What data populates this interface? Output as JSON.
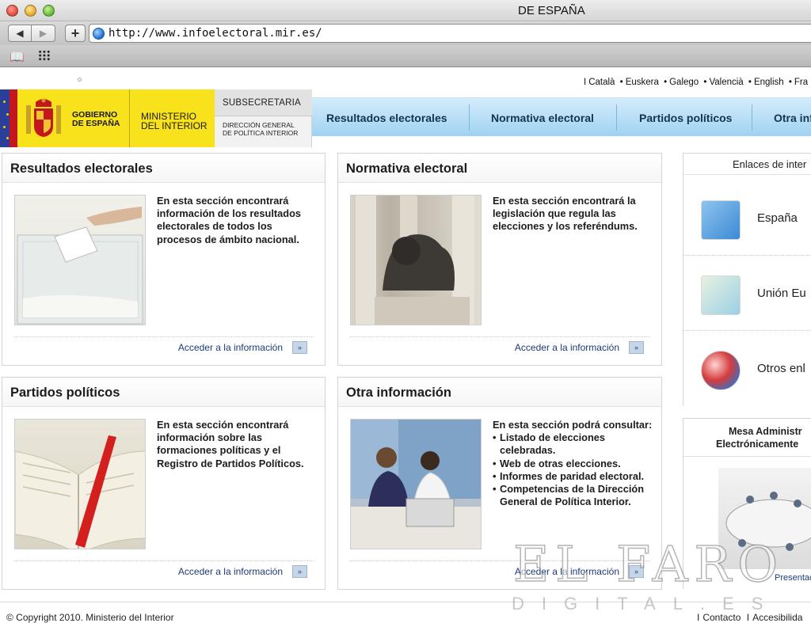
{
  "browser": {
    "window_title": "DE ESPAÑA",
    "url": "http://www.infoelectoral.mir.es/"
  },
  "languages": [
    "Català",
    "Euskera",
    "Galego",
    "Valencià",
    "English",
    "Fra"
  ],
  "header": {
    "gobierno": "GOBIERNO\nDE ESPAÑA",
    "ministerio": "MINISTERIO\nDEL INTERIOR",
    "subsecretaria": "SUBSECRETARIA",
    "direccion": "DIRECCIÓN GENERAL\nDE POLÍTICA INTERIOR",
    "nav": [
      "Resultados electorales",
      "Normativa electoral",
      "Partidos políticos",
      "Otra inf"
    ]
  },
  "cards": [
    {
      "title": "Resultados electorales",
      "desc": "En esta sección encontrará información de los resultados electorales de todos los procesos de ámbito nacional.",
      "link": "Acceder a la información",
      "image": "ballot-box"
    },
    {
      "title": "Normativa electoral",
      "desc": "En esta sección encontrará la legislación que regula las elecciones y los referéndums.",
      "link": "Acceder a la información",
      "image": "lion-statue"
    },
    {
      "title": "Partidos políticos",
      "desc": "En esta sección encontrará información sobre las formaciones políticas y el Registro de Partidos Políticos.",
      "link": "Acceder a la información",
      "image": "open-book"
    },
    {
      "title": "Otra información",
      "desc": "En esta sección podrá consultar:",
      "bullets": [
        "Listado de elecciones celebradas.",
        "Web de otras elecciones.",
        "Informes de paridad electoral.",
        "Competencias de la Dirección General de Política Interior."
      ],
      "link": "Acceder a la información",
      "image": "office-workers"
    }
  ],
  "sidebar": {
    "links_title": "Enlaces de inter",
    "links": [
      {
        "label": "España",
        "icon": "spain-map-icon"
      },
      {
        "label": "Unión Eu",
        "icon": "eu-map-icon"
      },
      {
        "label": "Otros enl",
        "icon": "flags-globe-icon"
      }
    ],
    "mesa_title_1": "Mesa Administr",
    "mesa_title_2": "Electrónicamente",
    "mesa_link": "Presentac"
  },
  "footer": {
    "copyright": "© Copyright 2010. Ministerio del Interior",
    "links": [
      "Contacto",
      "Accesibilida"
    ]
  },
  "watermark": {
    "line1": "EL FARO",
    "line2": "DIGITAL.ES"
  },
  "colors": {
    "flag_blue": "#2a3e9a",
    "flag_red": "#c4161c",
    "gov_yellow": "#f7e21c",
    "nav_blue": "#9fd2f2",
    "link_blue": "#1c3a7a"
  }
}
